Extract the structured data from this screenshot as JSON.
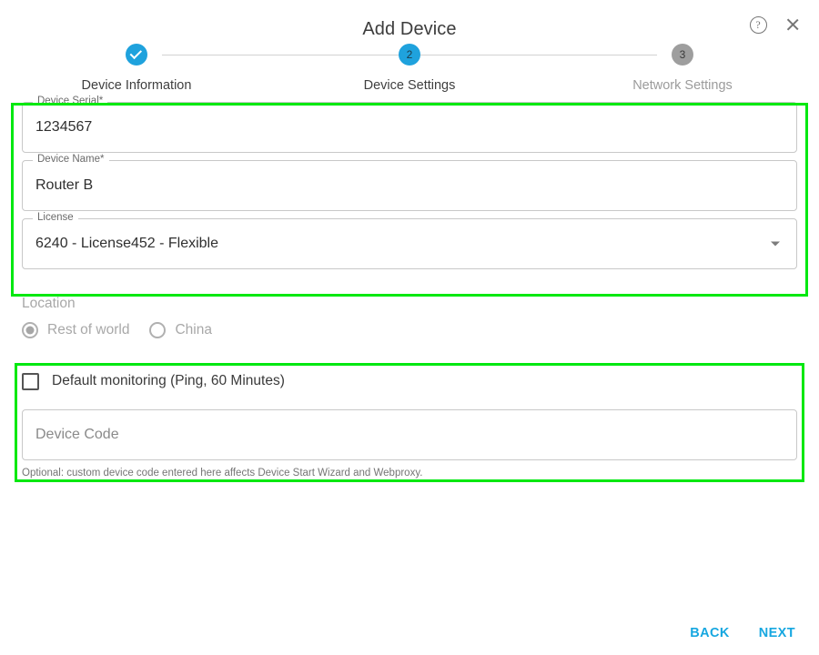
{
  "dialog": {
    "title": "Add Device",
    "help_icon": "help-circle-icon",
    "close_icon": "close-icon",
    "help_glyph": "?"
  },
  "stepper": {
    "steps": [
      {
        "number": "1",
        "label": "Device Information",
        "state": "done",
        "glyph": ""
      },
      {
        "number": "2",
        "label": "Device Settings",
        "state": "current",
        "glyph": "2"
      },
      {
        "number": "3",
        "label": "Network Settings",
        "state": "upcoming",
        "glyph": "3"
      }
    ]
  },
  "fields": {
    "device_serial": {
      "label": "Device Serial",
      "required_mark": "*",
      "value": "1234567"
    },
    "device_name": {
      "label": "Device Name",
      "required_mark": "*",
      "value": "Router B"
    },
    "license": {
      "label": "License",
      "value": "6240 - License452 - Flexible"
    }
  },
  "location": {
    "title": "Location",
    "options": [
      {
        "label": "Rest of world",
        "selected": true
      },
      {
        "label": "China",
        "selected": false
      }
    ]
  },
  "monitoring": {
    "checkbox_label": "Default monitoring (Ping, 60 Minutes)",
    "checked": false,
    "device_code_placeholder": "Device Code",
    "device_code_value": "",
    "hint": "Optional: custom device code entered here affects Device Start Wizard and Webproxy."
  },
  "footer": {
    "back_label": "BACK",
    "next_label": "NEXT"
  },
  "colors": {
    "accent_blue": "#1fa2dd",
    "link_blue": "#16a7e0",
    "highlight_green": "#00e810",
    "step_inactive": "#9e9e9e",
    "text_dark": "#3c3c3c",
    "text_muted": "#a8a8a8"
  }
}
